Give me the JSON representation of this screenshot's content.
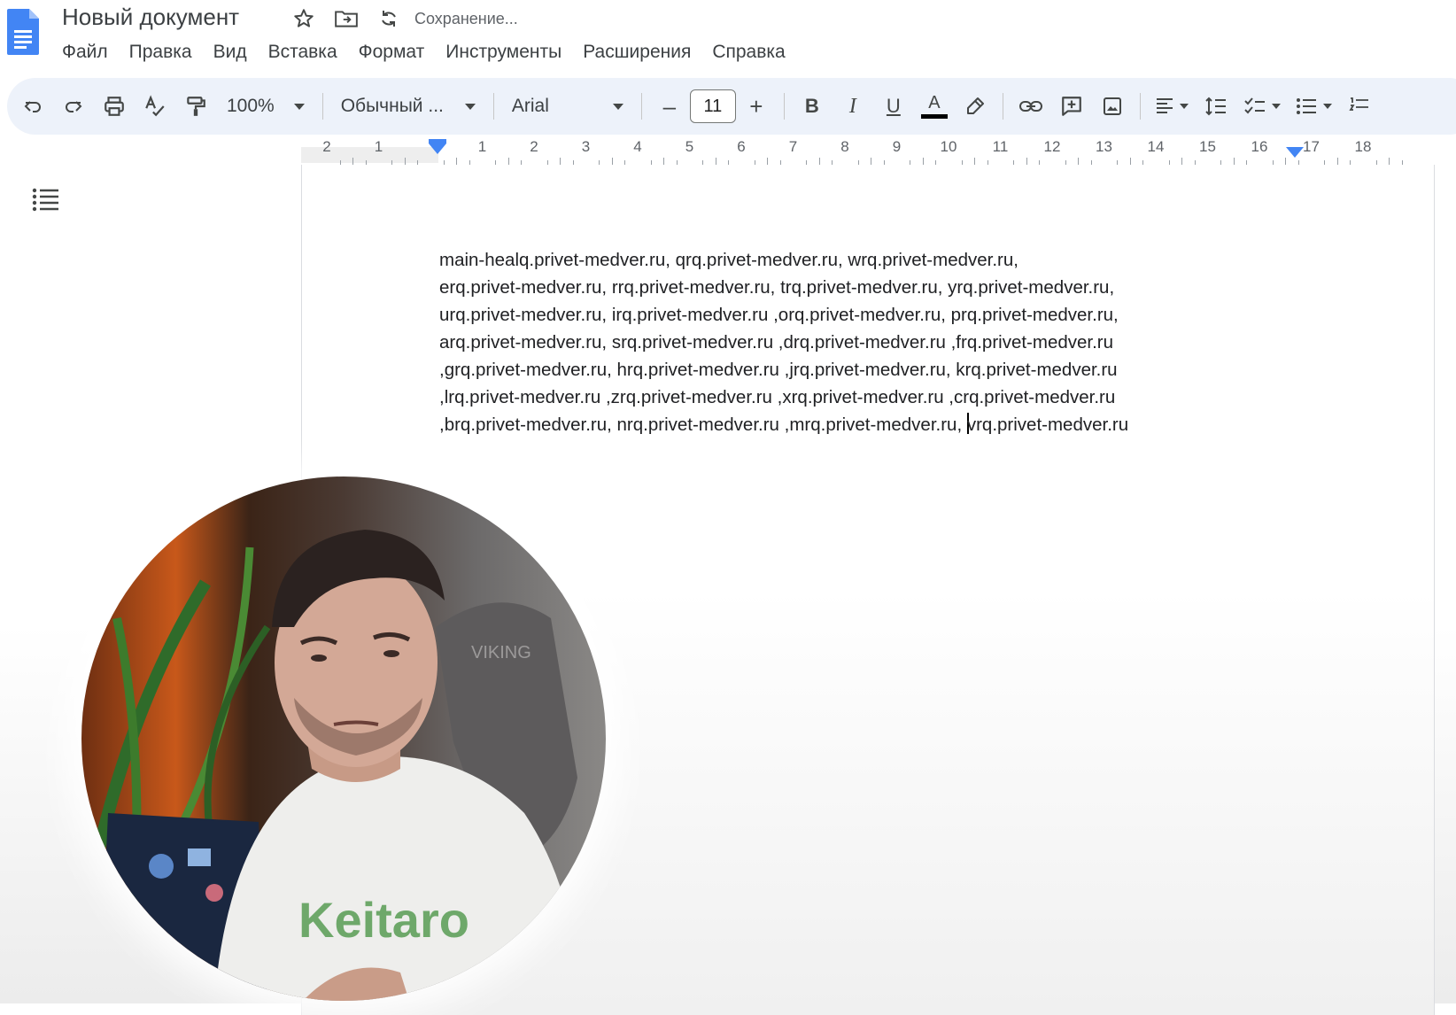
{
  "document": {
    "title": "Новый документ",
    "save_status": "Сохранение..."
  },
  "menu": [
    "Файл",
    "Правка",
    "Вид",
    "Вставка",
    "Формат",
    "Инструменты",
    "Расширения",
    "Справка"
  ],
  "toolbar": {
    "zoom": "100%",
    "style": "Обычный ...",
    "font": "Arial",
    "font_size": "11",
    "decrease_label": "–",
    "increase_label": "+",
    "bold_label": "B",
    "italic_label": "I",
    "underline_label": "U",
    "text_color_label": "A",
    "text_color": "#000000"
  },
  "ruler": {
    "numbers": [
      "2",
      "1",
      "",
      "1",
      "2",
      "3",
      "4",
      "5",
      "6",
      "7",
      "8",
      "9",
      "10",
      "11",
      "12",
      "13",
      "14",
      "15",
      "16",
      "17",
      "18"
    ]
  },
  "body": {
    "lines": [
      "main-healq.privet-medver.ru, qrq.privet-medver.ru, wrq.privet-medver.ru,",
      "erq.privet-medver.ru, rrq.privet-medver.ru, trq.privet-medver.ru, yrq.privet-medver.ru,",
      "urq.privet-medver.ru, irq.privet-medver.ru ,orq.privet-medver.ru, prq.privet-medver.ru,",
      "arq.privet-medver.ru, srq.privet-medver.ru ,drq.privet-medver.ru ,frq.privet-medver.ru",
      ",grq.privet-medver.ru, hrq.privet-medver.ru ,jrq.privet-medver.ru, krq.privet-medver.ru",
      ",lrq.privet-medver.ru ,zrq.privet-medver.ru ,xrq.privet-medver.ru ,crq.privet-medver.ru",
      ",brq.privet-medver.ru, nrq.privet-medver.ru ,mrq.privet-medver.ru, "
    ],
    "last_line_after_cursor": "vrq.privet-medver.ru"
  },
  "webcam": {
    "shirt_text": "Keitaro",
    "chair_text": "VIKING"
  },
  "colors": {
    "accent": "#4285f4",
    "toolbar_bg": "#edf2fa"
  }
}
